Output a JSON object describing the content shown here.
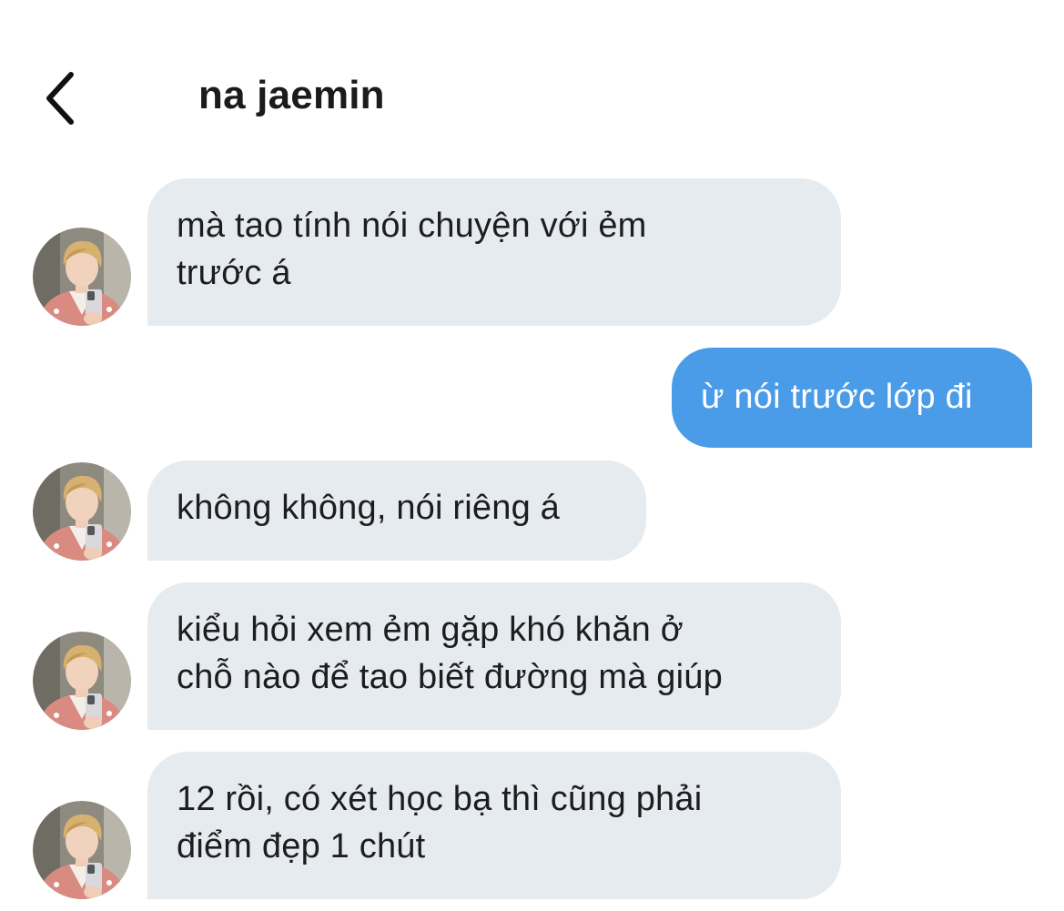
{
  "header": {
    "title": "na jaemin",
    "back_icon": "chevron-left-icon"
  },
  "colors": {
    "incoming_bubble": "#e6ebf0",
    "outgoing_bubble": "#4a9ce8",
    "outgoing_text": "#ffffff"
  },
  "messages": [
    {
      "sender": "na jaemin",
      "lines": [
        "mà tao tính nói chuyện với ẻm",
        "trước á"
      ]
    },
    {
      "sender": "me",
      "lines": [
        "ừ nói trước lớp đi"
      ]
    },
    {
      "sender": "na jaemin",
      "lines": [
        "không không, nói riêng á"
      ]
    },
    {
      "sender": "na jaemin",
      "lines": [
        "kiểu hỏi xem ẻm gặp khó khăn ở",
        "chỗ nào để tao biết đường mà giúp"
      ]
    },
    {
      "sender": "na jaemin",
      "lines": [
        "12 rồi, có xét học bạ thì cũng phải",
        "điểm đẹp 1 chút"
      ]
    }
  ]
}
